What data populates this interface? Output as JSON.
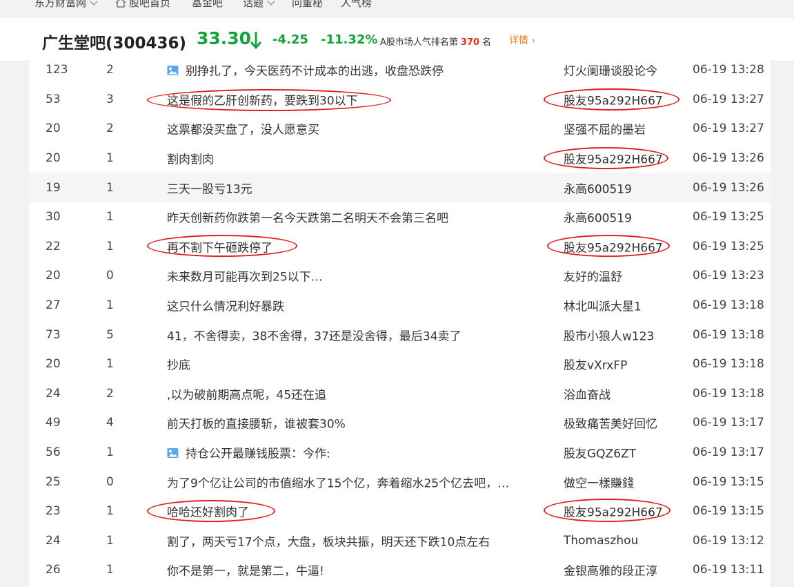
{
  "topnav": {
    "items": [
      "东方财富网",
      "股吧首页",
      "基金吧",
      "话题",
      "问董秘",
      "人气榜"
    ]
  },
  "header": {
    "bar_name": "广生堂吧(300436)",
    "price": "33.30",
    "change": "-4.25",
    "change_pct": "-11.32%",
    "rank_prefix": "A股市场人气排名第",
    "rank_num": "370",
    "rank_suffix": "名",
    "detail_label": "详情"
  },
  "colors": {
    "down_green": "#11a53a",
    "rank_red": "#e0301e",
    "link_orange": "#f07c1d",
    "annotation_red": "#e21d1d"
  },
  "rows": [
    {
      "read": "123",
      "reply": "2",
      "title": "别挣扎了，今天医药不计成本的出逃，收盘恐跌停",
      "author": "灯火阑珊谈股论今",
      "time": "06-19 13:28",
      "img": true
    },
    {
      "read": "53",
      "reply": "3",
      "title": "这是假的乙肝创新药，要跌到30以下",
      "author": "股友95a292H667",
      "time": "06-19 13:27",
      "img": false
    },
    {
      "read": "20",
      "reply": "2",
      "title": "这票都没买盘了，没人愿意买",
      "author": "坚强不屈的墨岩",
      "time": "06-19 13:27",
      "img": false
    },
    {
      "read": "20",
      "reply": "1",
      "title": "割肉割肉",
      "author": "股友95a292H667",
      "time": "06-19 13:26",
      "img": false
    },
    {
      "read": "19",
      "reply": "1",
      "title": "三天一股亏13元",
      "author": "永高600519",
      "time": "06-19 13:26",
      "img": false
    },
    {
      "read": "30",
      "reply": "1",
      "title": "昨天创新药你跌第一名今天跌第二名明天不会第三名吧",
      "author": "永高600519",
      "time": "06-19 13:25",
      "img": false
    },
    {
      "read": "22",
      "reply": "1",
      "title": "再不割下午砸跌停了",
      "author": "股友95a292H667",
      "time": "06-19 13:25",
      "img": false
    },
    {
      "read": "20",
      "reply": "0",
      "title": "未来数月可能再次到25以下…",
      "author": "友好的温舒",
      "time": "06-19 13:23",
      "img": false
    },
    {
      "read": "27",
      "reply": "1",
      "title": "这只什么情况利好暴跌",
      "author": "林北叫派大星1",
      "time": "06-19 13:18",
      "img": false
    },
    {
      "read": "73",
      "reply": "5",
      "title": "41，不舍得卖，38不舍得，37还是没舍得，最后34卖了",
      "author": "股市小狼人w123",
      "time": "06-19 13:18",
      "img": false
    },
    {
      "read": "20",
      "reply": "1",
      "title": "抄底",
      "author": "股友vXrxFP",
      "time": "06-19 13:18",
      "img": false
    },
    {
      "read": "24",
      "reply": "2",
      "title": ",以为破前期高点呢，45还在追",
      "author": "浴血奋战",
      "time": "06-19 13:18",
      "img": false
    },
    {
      "read": "49",
      "reply": "4",
      "title": "前天打板的直接腰斩，谁被套30%",
      "author": "极致痛苦美好回忆",
      "time": "06-19 13:17",
      "img": false
    },
    {
      "read": "56",
      "reply": "1",
      "title": "持仓公开最赚钱股票：今作:",
      "author": "股友GQZ6ZT",
      "time": "06-19 13:17",
      "img": true
    },
    {
      "read": "25",
      "reply": "0",
      "title": "为了9个亿让公司的市值缩水了15个亿，奔着缩水25个亿去吧，…",
      "author": "做空一樣賺錢",
      "time": "06-19 13:15",
      "img": false
    },
    {
      "read": "23",
      "reply": "1",
      "title": "哈哈还好割肉了",
      "author": "股友95a292H667",
      "time": "06-19 13:15",
      "img": false
    },
    {
      "read": "24",
      "reply": "1",
      "title": "割了，两天亏17个点，大盘，板块共振，明天还下跌10点左右",
      "author": "Thomaszhou",
      "time": "06-19 13:12",
      "img": false
    },
    {
      "read": "26",
      "reply": "1",
      "title": "你不是第一，就是第二，牛逼!",
      "author": "金银高雅的段正淳",
      "time": "06-19 13:11",
      "img": false
    }
  ]
}
